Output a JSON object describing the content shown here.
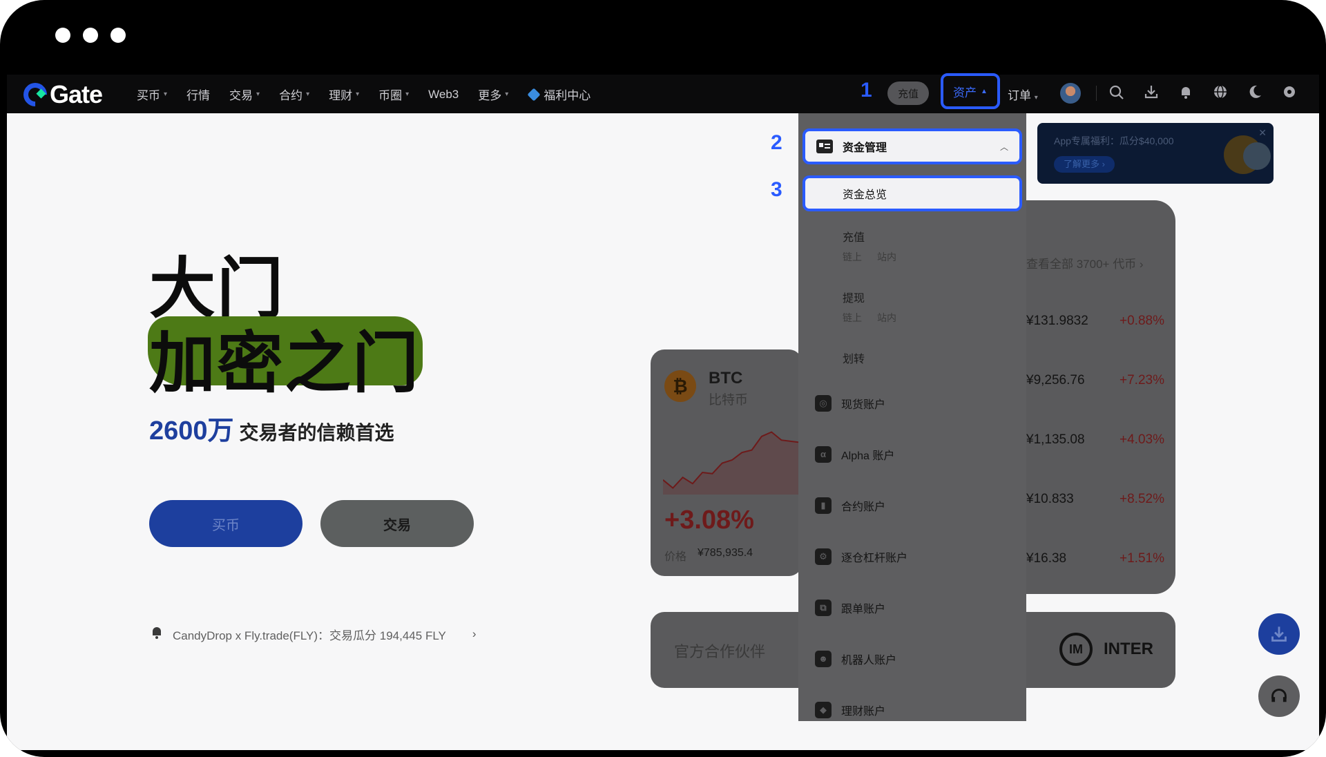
{
  "nav": {
    "logo": "Gate",
    "menu": [
      {
        "label": "买币",
        "caret": true
      },
      {
        "label": "行情",
        "caret": false
      },
      {
        "label": "交易",
        "caret": true
      },
      {
        "label": "合约",
        "caret": true
      },
      {
        "label": "理财",
        "caret": true
      },
      {
        "label": "币圈",
        "caret": true
      },
      {
        "label": "Web3",
        "caret": false
      },
      {
        "label": "更多",
        "caret": true
      }
    ],
    "welfare": "福利中心",
    "deposit": "充值",
    "assets": "资产",
    "orders": "订单"
  },
  "steps": [
    "1",
    "2",
    "3"
  ],
  "hero": {
    "line1": "大门",
    "line2": "加密之门",
    "number": "2600万",
    "subtitle": "交易者的信赖首选",
    "buy": "买币",
    "trade": "交易",
    "news": "CandyDrop x Fly.trade(FLY)：交易瓜分 194,445 FLY"
  },
  "btc": {
    "symbol": "BTC",
    "name": "比特币",
    "change": "+3.08%",
    "price_label": "价格",
    "price": "¥785,935.4",
    "spark": [
      0.18,
      0.05,
      0.22,
      0.12,
      0.3,
      0.28,
      0.45,
      0.5,
      0.62,
      0.66,
      0.88,
      0.95,
      0.82,
      0.8,
      0.78
    ]
  },
  "market": {
    "view_all": "查看全部 3700+ 代币",
    "rows": [
      {
        "price": "¥131.9832",
        "change": "+0.88%"
      },
      {
        "price": "¥9,256.76",
        "change": "+7.23%"
      },
      {
        "price": "¥1,135.08",
        "change": "+4.03%"
      },
      {
        "price": "¥10.833",
        "change": "+8.52%"
      },
      {
        "price": "¥16.38",
        "change": "+1.51%"
      }
    ]
  },
  "partner": {
    "label": "官方合作伙伴",
    "brand": "INTER"
  },
  "promo": {
    "title": "App专属福利：瓜分$40,000",
    "button": "了解更多"
  },
  "dropdown": {
    "header": "资金管理",
    "overview": "资金总览",
    "deposit": {
      "label": "充值",
      "sub": [
        "链上",
        "站内"
      ]
    },
    "withdraw": {
      "label": "提现",
      "sub": [
        "链上",
        "站内"
      ]
    },
    "transfer": "划转",
    "accounts": [
      {
        "label": "现货账户",
        "icon": "spot-icon"
      },
      {
        "label": "Alpha 账户",
        "icon": "alpha-icon"
      },
      {
        "label": "合约账户",
        "icon": "futures-icon"
      },
      {
        "label": "逐仓杠杆账户",
        "icon": "margin-icon"
      },
      {
        "label": "跟单账户",
        "icon": "copy-icon"
      },
      {
        "label": "机器人账户",
        "icon": "robot-icon"
      },
      {
        "label": "理财账户",
        "icon": "earn-icon"
      }
    ]
  }
}
